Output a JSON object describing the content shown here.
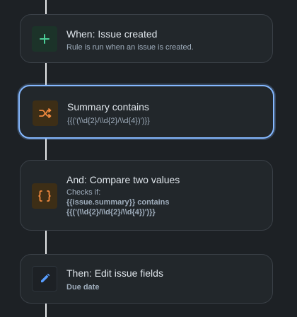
{
  "rule_flow": {
    "steps": [
      {
        "title": "When: Issue created",
        "description": "Rule is run when an issue is created.",
        "icon": "plus-icon",
        "icon_color": "#4bce97",
        "icon_bg": "#1c3329"
      },
      {
        "title": "Summary contains",
        "description": "{{('(\\\\d{2}/\\\\d{2}/\\\\d{4})')}}",
        "icon": "shuffle-icon",
        "icon_color": "#f38a3f",
        "icon_bg": "#3d2e16",
        "selected": true
      },
      {
        "title": "And: Compare two values",
        "checks_label": "Checks if:",
        "line1": "{{issue.summary}} contains",
        "line2": "{{('(\\\\d{2}/\\\\d{2}/\\\\d{4})')}}",
        "icon": "curly-braces-icon",
        "icon_color": "#f38a3f",
        "icon_bg": "#3d2e16"
      },
      {
        "title": "Then: Edit issue fields",
        "description": "Due date",
        "icon": "pencil-icon",
        "icon_color": "#579dff",
        "icon_bg": "#1d2125"
      }
    ]
  },
  "colors": {
    "background": "#1d2125",
    "card": "#22272b",
    "selected_border": "#85b8ff"
  }
}
